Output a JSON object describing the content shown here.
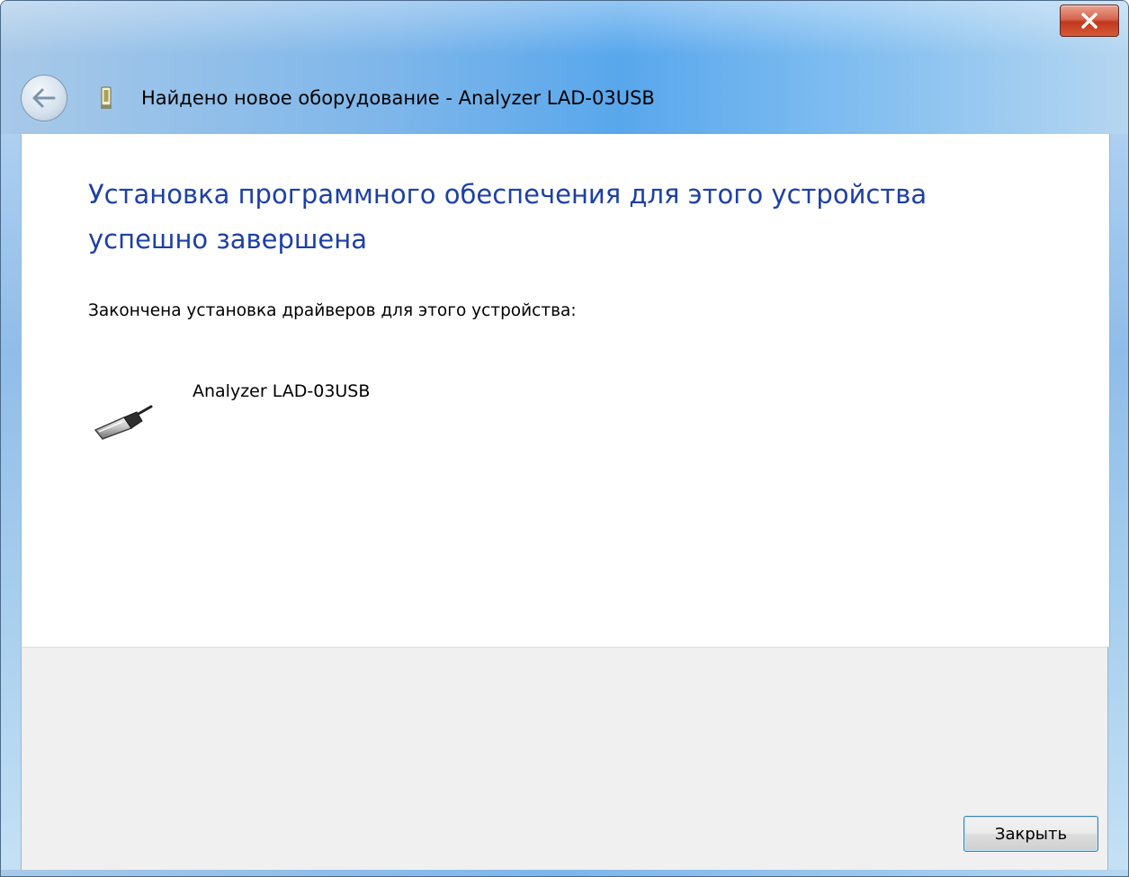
{
  "window": {
    "title": "Найдено новое оборудование - Analyzer LAD-03USB"
  },
  "content": {
    "heading": "Установка программного обеспечения для этого устройства успешно завершена",
    "description": "Закончена установка драйверов для этого устройства:",
    "device": {
      "name": "Analyzer LAD-03USB",
      "icon": "usb-connector-icon"
    }
  },
  "footer": {
    "close_label": "Закрыть"
  },
  "colors": {
    "heading": "#1d3fa8",
    "close_button": "#c1381d",
    "footer_bg": "#f0f0f0"
  }
}
